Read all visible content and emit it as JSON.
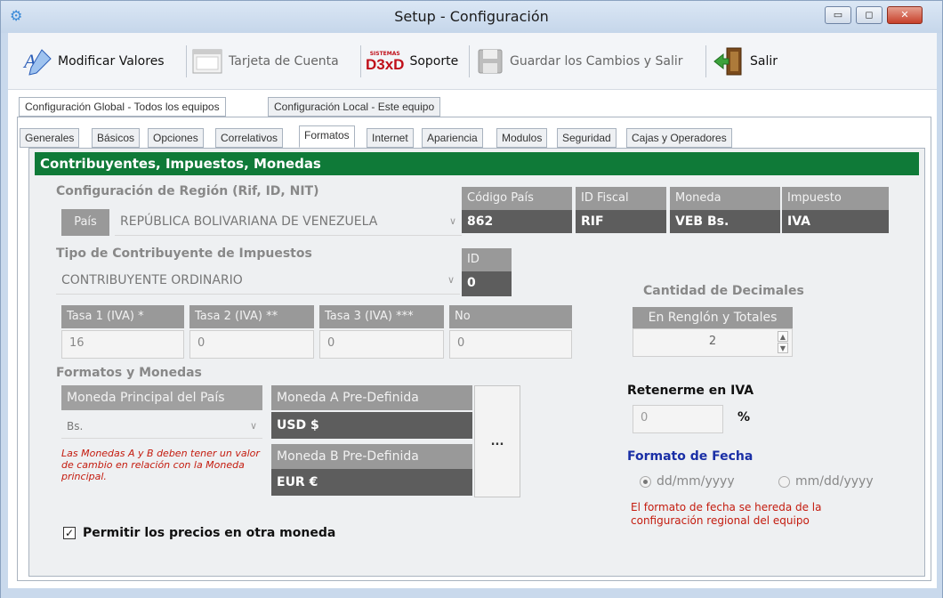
{
  "window": {
    "title": "Setup - Configuración",
    "minimize": "▭",
    "maximize": "◻",
    "close": "✕"
  },
  "toolbar": {
    "modificar": "Modificar Valores",
    "tarjeta": "Tarjeta de Cuenta",
    "soporte_logo_top": "SISTEMAS",
    "soporte_logo": "D3xD",
    "soporte": "Soporte",
    "guardar": "Guardar los Cambios  y Salir",
    "salir": "Salir"
  },
  "outer_tabs": [
    "Configuración Global - Todos los equipos",
    "Configuración Local - Este equipo"
  ],
  "inner_tabs": [
    "Generales",
    "Básicos",
    "Opciones",
    "Correlativos",
    "Formatos",
    "Internet",
    "Apariencia",
    "Modulos",
    "Seguridad",
    "Cajas y Operadores"
  ],
  "section_title": "Contribuyentes, Impuestos, Monedas",
  "region": {
    "title": "Configuración de Región  (Rif, ID, NIT)",
    "pais_label": "País",
    "pais_value": "REPÚBLICA BOLIVARIANA DE VENEZUELA",
    "codigo_label": "Código País",
    "codigo_value": "862",
    "idfiscal_label": "ID Fiscal",
    "idfiscal_value": "RIF",
    "moneda_label": "Moneda",
    "moneda_value": "VEB Bs.",
    "impuesto_label": "Impuesto",
    "impuesto_value": "IVA"
  },
  "contribuyente": {
    "title": "Tipo de Contribuyente de Impuestos",
    "value": "CONTRIBUYENTE ORDINARIO",
    "id_label": "ID",
    "id_value": "0"
  },
  "tasas": {
    "t1_label": "Tasa 1 (IVA) *",
    "t1_value": "16",
    "t2_label": "Tasa 2 (IVA) **",
    "t2_value": "0",
    "t3_label": "Tasa 3 (IVA) ***",
    "t3_value": "0",
    "no_label": "No",
    "no_value": "0"
  },
  "decimales": {
    "title": "Cantidad de Decimales",
    "label": "En Renglón y Totales",
    "value": "2"
  },
  "formatos": {
    "title": "Formatos y Monedas",
    "principal_label": "Moneda Principal del País",
    "principal_value": "Bs.",
    "a_label": "Moneda A Pre-Definida",
    "a_value": "USD $",
    "b_label": "Moneda B Pre-Definida",
    "b_value": "EUR €",
    "more_button": "...",
    "note": "Las Monedas A y B deben tener un valor de cambio en relación con la Moneda principal."
  },
  "retener": {
    "title": "Retenerme en IVA",
    "value": "0",
    "unit": "%"
  },
  "fecha": {
    "title": "Formato de Fecha",
    "opt1": "dd/mm/yyyy",
    "opt2": "mm/dd/yyyy",
    "selected": "dd/mm/yyyy",
    "note": "El formato de fecha se hereda de la configuración regional del equipo"
  },
  "permitir": {
    "label": "Permitir los precios en otra moneda",
    "checked": true
  },
  "colors": {
    "green_header": "#0f7a38",
    "gray_header": "#999999",
    "dark_value": "#5d5d5d",
    "red_note": "#c41b0e",
    "blue_title": "#1a2fa6"
  }
}
